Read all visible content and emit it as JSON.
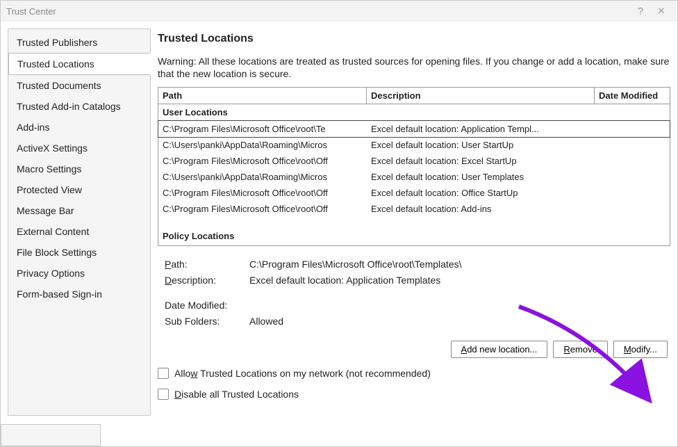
{
  "window": {
    "title": "Trust Center"
  },
  "sidebar": {
    "items": [
      {
        "label": "Trusted Publishers"
      },
      {
        "label": "Trusted Locations"
      },
      {
        "label": "Trusted Documents"
      },
      {
        "label": "Trusted Add-in Catalogs"
      },
      {
        "label": "Add-ins"
      },
      {
        "label": "ActiveX Settings"
      },
      {
        "label": "Macro Settings"
      },
      {
        "label": "Protected View"
      },
      {
        "label": "Message Bar"
      },
      {
        "label": "External Content"
      },
      {
        "label": "File Block Settings"
      },
      {
        "label": "Privacy Options"
      },
      {
        "label": "Form-based Sign-in"
      }
    ],
    "selected_index": 1
  },
  "heading": "Trusted Locations",
  "warning": "Warning: All these locations are treated as trusted sources for opening files.  If you change or add a location, make sure that the new location is secure.",
  "table": {
    "columns": {
      "path": "Path",
      "desc": "Description",
      "date": "Date Modified"
    },
    "group_user": "User Locations",
    "group_policy": "Policy Locations",
    "rows": [
      {
        "path": "C:\\Program Files\\Microsoft Office\\root\\Te",
        "desc": "Excel default location: Application Templ...",
        "selected": true
      },
      {
        "path": "C:\\Users\\panki\\AppData\\Roaming\\Micros",
        "desc": "Excel default location: User StartUp"
      },
      {
        "path": "C:\\Program Files\\Microsoft Office\\root\\Off",
        "desc": "Excel default location: Excel StartUp"
      },
      {
        "path": "C:\\Users\\panki\\AppData\\Roaming\\Micros",
        "desc": "Excel default location: User Templates"
      },
      {
        "path": "C:\\Program Files\\Microsoft Office\\root\\Off",
        "desc": "Excel default location: Office StartUp"
      },
      {
        "path": "C:\\Program Files\\Microsoft Office\\root\\Off",
        "desc": "Excel default location: Add-ins"
      }
    ]
  },
  "details": {
    "path_label": "Path:",
    "path_value": "C:\\Program Files\\Microsoft Office\\root\\Templates\\",
    "desc_label": "Description:",
    "desc_value": "Excel default location: Application Templates",
    "date_label": "Date Modified:",
    "date_value": "",
    "sub_label": "Sub Folders:",
    "sub_value": "Allowed"
  },
  "buttons": {
    "add": "Add new location...",
    "remove": "Remove",
    "modify": "Modify..."
  },
  "checkboxes": {
    "allow_network": "Allow Trusted Locations on my network (not recommended)",
    "disable_all": "Disable all Trusted Locations"
  },
  "annotations": {
    "highlight_color": "#8a12e0"
  }
}
